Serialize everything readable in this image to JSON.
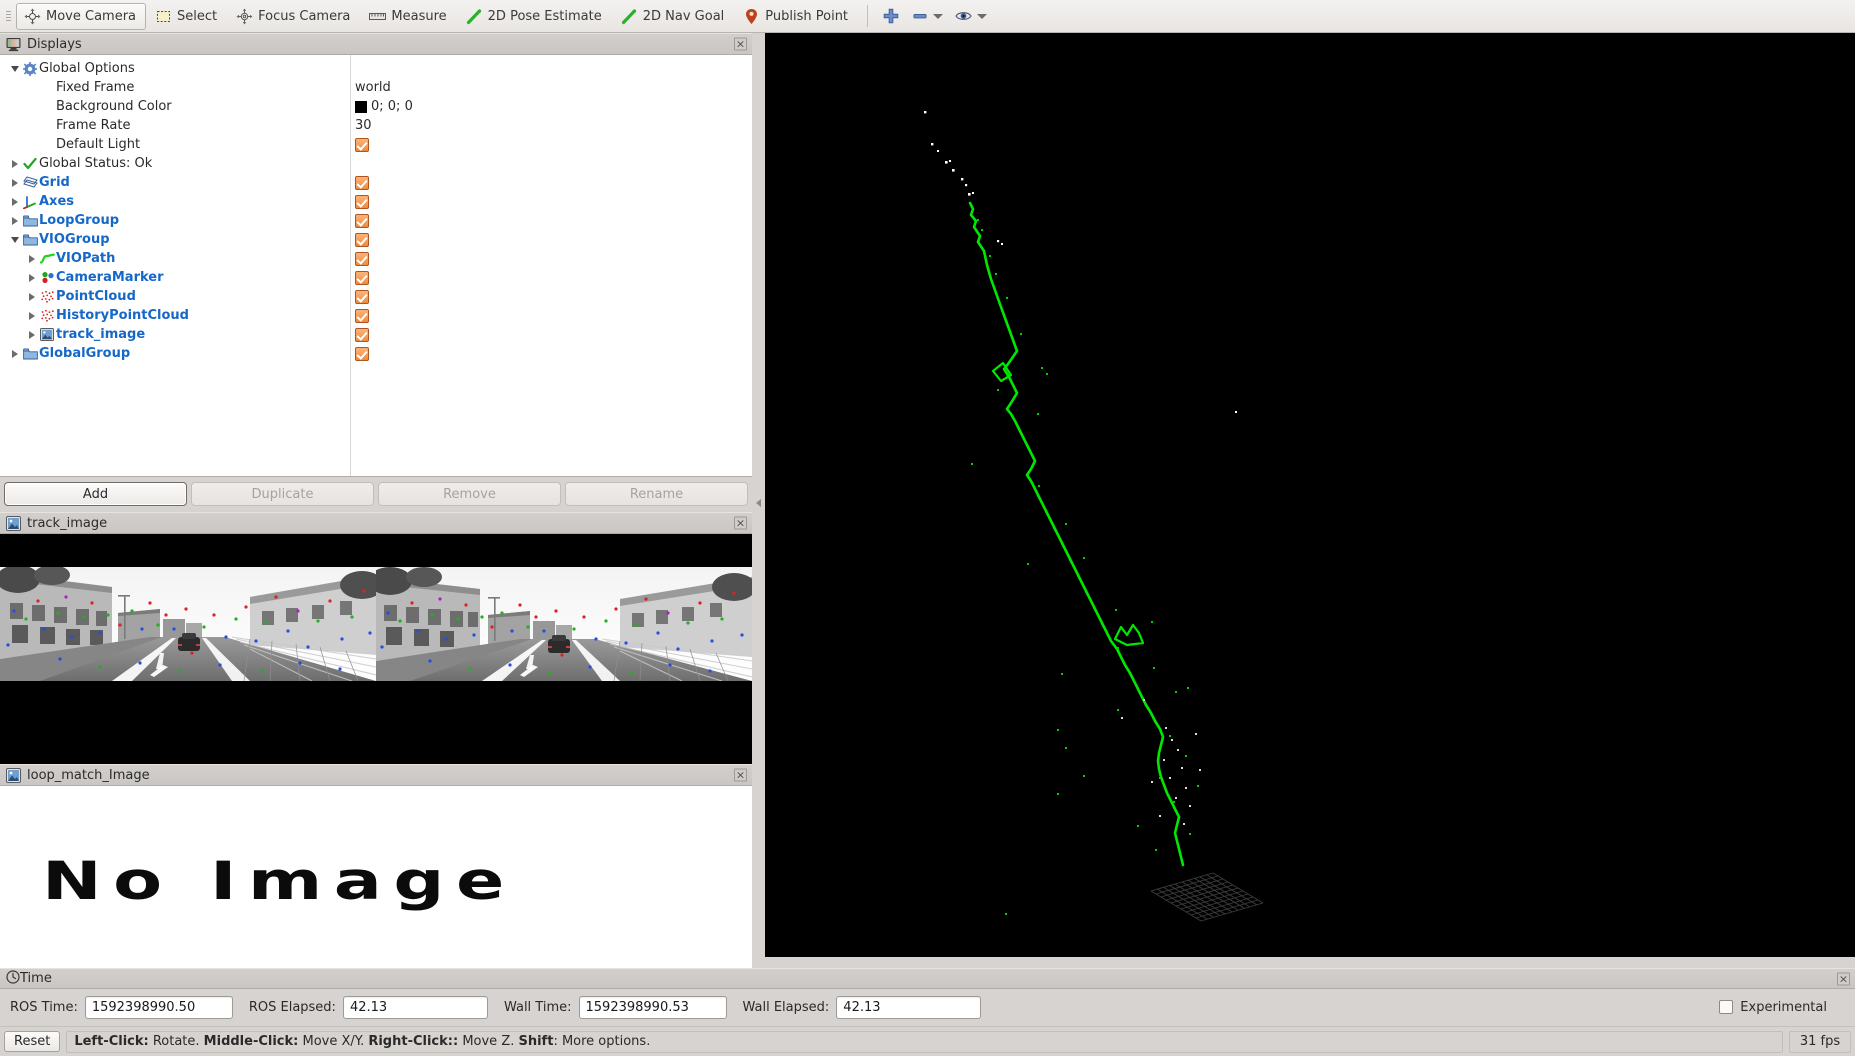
{
  "toolbar": {
    "tools": [
      {
        "label": "Move Camera",
        "icon": "move-camera-icon",
        "active": true
      },
      {
        "label": "Select",
        "icon": "select-icon",
        "active": false
      },
      {
        "label": "Focus Camera",
        "icon": "focus-camera-icon",
        "active": false
      },
      {
        "label": "Measure",
        "icon": "measure-icon",
        "active": false
      },
      {
        "label": "2D Pose Estimate",
        "icon": "pose-estimate-icon",
        "active": false
      },
      {
        "label": "2D Nav Goal",
        "icon": "nav-goal-icon",
        "active": false
      },
      {
        "label": "Publish Point",
        "icon": "publish-point-icon",
        "active": false
      }
    ],
    "extra": {
      "add_icon": "plus-icon",
      "remove_icon": "minus-icon",
      "visibility_icon": "eye-icon"
    }
  },
  "displays_panel": {
    "title": "Displays",
    "close_label": "×",
    "tree": [
      {
        "indent": 0,
        "arrow": "down",
        "icon": "gear-icon",
        "label": "Global Options",
        "style": "plain",
        "value_type": "none"
      },
      {
        "indent": 1,
        "arrow": "none",
        "icon": "none",
        "label": "Fixed Frame",
        "style": "plain",
        "value_type": "text",
        "value": "world"
      },
      {
        "indent": 1,
        "arrow": "none",
        "icon": "none",
        "label": "Background Color",
        "style": "plain",
        "value_type": "color",
        "value": "0; 0; 0"
      },
      {
        "indent": 1,
        "arrow": "none",
        "icon": "none",
        "label": "Frame Rate",
        "style": "plain",
        "value_type": "text",
        "value": "30"
      },
      {
        "indent": 1,
        "arrow": "none",
        "icon": "none",
        "label": "Default Light",
        "style": "plain",
        "value_type": "checkbox",
        "value": "checked"
      },
      {
        "indent": 0,
        "arrow": "right",
        "icon": "check-ok-icon",
        "label": "Global Status: Ok",
        "style": "plain",
        "value_type": "none"
      },
      {
        "indent": 0,
        "arrow": "right",
        "icon": "grid-icon",
        "label": "Grid",
        "style": "blue",
        "value_type": "checkbox",
        "value": "checked"
      },
      {
        "indent": 0,
        "arrow": "right",
        "icon": "axes-icon",
        "label": "Axes",
        "style": "blue",
        "value_type": "checkbox",
        "value": "checked"
      },
      {
        "indent": 0,
        "arrow": "right",
        "icon": "folder-icon",
        "label": "LoopGroup",
        "style": "blue",
        "value_type": "checkbox",
        "value": "checked"
      },
      {
        "indent": 0,
        "arrow": "down",
        "icon": "folder-icon",
        "label": "VIOGroup",
        "style": "blue",
        "value_type": "checkbox",
        "value": "checked"
      },
      {
        "indent": 1,
        "arrow": "right",
        "icon": "path-icon",
        "label": "VIOPath",
        "style": "blue",
        "value_type": "checkbox",
        "value": "checked"
      },
      {
        "indent": 1,
        "arrow": "right",
        "icon": "marker-icon",
        "label": "CameraMarker",
        "style": "blue",
        "value_type": "checkbox",
        "value": "checked"
      },
      {
        "indent": 1,
        "arrow": "right",
        "icon": "pointcloud-icon",
        "label": "PointCloud",
        "style": "blue",
        "value_type": "checkbox",
        "value": "checked"
      },
      {
        "indent": 1,
        "arrow": "right",
        "icon": "pointcloud-icon",
        "label": "HistoryPointCloud",
        "style": "blue",
        "value_type": "checkbox",
        "value": "checked"
      },
      {
        "indent": 1,
        "arrow": "right",
        "icon": "image-icon",
        "label": "track_image",
        "style": "blue",
        "value_type": "checkbox",
        "value": "checked"
      },
      {
        "indent": 0,
        "arrow": "right",
        "icon": "folder-icon",
        "label": "GlobalGroup",
        "style": "blue",
        "value_type": "checkbox",
        "value": "checked"
      }
    ],
    "buttons": {
      "add": "Add",
      "duplicate": "Duplicate",
      "remove": "Remove",
      "rename": "Rename"
    }
  },
  "track_image_panel": {
    "title": "track_image",
    "close_label": "×"
  },
  "loop_match_panel": {
    "title": "loop_match_Image",
    "close_label": "×",
    "no_image_text": "No Image"
  },
  "time_panel": {
    "title": "Time",
    "close_label": "×",
    "fields": [
      {
        "label": "ROS Time:",
        "value": "1592398990.50"
      },
      {
        "label": "ROS Elapsed:",
        "value": "42.13"
      },
      {
        "label": "Wall Time:",
        "value": "1592398990.53"
      },
      {
        "label": "Wall Elapsed:",
        "value": "42.13"
      }
    ],
    "experimental_label": "Experimental",
    "experimental_checked": false
  },
  "status_bar": {
    "reset_label": "Reset",
    "hint_segments": [
      {
        "text": "Left-Click:",
        "bold": true
      },
      {
        "text": " Rotate. ",
        "bold": false
      },
      {
        "text": "Middle-Click:",
        "bold": true
      },
      {
        "text": " Move X/Y. ",
        "bold": false
      },
      {
        "text": "Right-Click::",
        "bold": true
      },
      {
        "text": " Move Z. ",
        "bold": false
      },
      {
        "text": "Shift",
        "bold": true
      },
      {
        "text": ": More options.",
        "bold": false
      }
    ],
    "hint_plain": "Left-Click: Rotate. Middle-Click: Move X/Y. Right-Click:: Move Z. Shift: More options.",
    "fps": "31 fps"
  },
  "view3d": {
    "background_color": "#000000",
    "path_color": "#00e000",
    "grid_color": "#3a3a3a",
    "point_color_white": "#ffffff"
  }
}
